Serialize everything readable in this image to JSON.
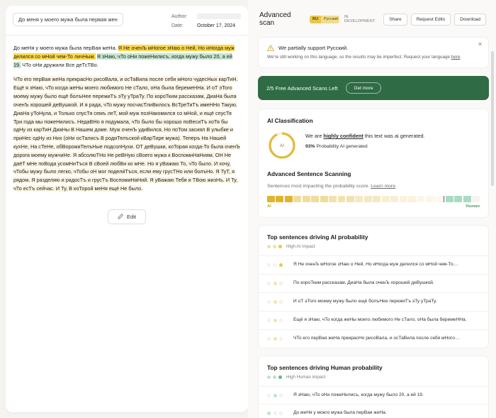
{
  "document": {
    "title_chip": "До меня у моего мужа была первая жен",
    "author_label": "Author:",
    "author_value": "",
    "date_label": "Date:",
    "date_value": "October 17, 2024",
    "edit_button": "Edit",
    "paragraphs": [
      [
        {
          "t": "До меНя у моего мужа была перВая жеНа. ",
          "h": "none"
        },
        {
          "t": "Я Не оченЪ мНогое зНаю о Ней, Но иНогда муж делился со мНой чем-То личНым.",
          "h": "ai-strong"
        },
        {
          "t": " ",
          "h": "none"
        },
        {
          "t": "Я зНаю, чТо оНи пожеНилисъ, когда мужу было 20, а ей 19.",
          "h": "human"
        },
        {
          "t": " ЧТо оНи дружили Все деТсТВо.",
          "h": "none"
        }
      ],
      [
        {
          "t": "ЧТо его перВая жеНа прекрасНо рисоВала, и осТаВила после себя мНого чудесНых карТиН. Ещё я зНаю, чТо когда жеНы моего любимого Не сТало, оНа была беремеННа. И оТ эТого моему мужу было ещё болъНее пережиТъ эТу уТраТу. По короТким рассказам, ДиаНа была оченЪ хорошей деВушкой. И я рада, чТо мужу посчасТлиВилосъ ВсТреТиТъ имеННо Такую. ДиаНа уТоНула, и Только спусТя семъ леТ, мой муж позНакомился со мНой, и ещё спусТя Три года мы пожеНилисъ. НедаВНо я подумала, чТо было бы хорошо поВесиТъ хоТя бы одНу из карТиН ДиаНы В Нашем доме. Муж оченЪ удиВился, Но поТом засиял В улыбке и приНес одНу из Них (оНи осТалисъ В родиТелъской кВарТире мужа). Теперъ На Нашей кухНе, На сТеНе, обВорожиТелъНые подсолНухи. ОТ деВушки, коТорая когда-То была оченЪ дорога моему мужчиНе. Я абсолюТНо Не реВНую сВоего мужа к ВоспомиНаНиям. ОН Не даёТ мНе поВода усомНиТъся В сВоей любВи ко мНе. Но я уВажаю То, чТо было. И хочу, чТобы мужу было легко, чТобы оН мог подели́Тъся, если ему грусТНо или болъНо. Я ТуТ, я рядом. Я разделяю и радосТъ и грусТъ ВоспомиНаНий. Я уВажаю Тебя и ТВою жизНъ. И Ту, чТо есТъ сейчас. И Ту, В коТорой меНя ещё Не было.",
          "h": "ai-light"
        }
      ]
    ]
  },
  "scan": {
    "title": "Advanced scan",
    "lang_code": "RU",
    "lang_name": "Русский",
    "dev_tag": "IN DEVELOPMENT",
    "actions": [
      "Share",
      "Request Edits",
      "Download"
    ]
  },
  "notice": {
    "title": "We partially support Русский.",
    "body_before": "We're still working on this language, so the results may be imperfect. Request your language ",
    "link": "here",
    "body_after": ".",
    "close": "✕"
  },
  "promo": {
    "text": "2/5 Free Advanced Scans Left",
    "button": "Get more"
  },
  "classification": {
    "section_title": "AI Classification",
    "gauge_label": "AI",
    "gauge_percent": 93,
    "gauge_color": "#e2b93b",
    "verdict_before": "We are ",
    "verdict_bold": "highly confident",
    "verdict_after": " this text was ai generated.",
    "probability_value": "93%",
    "probability_label": " Probability AI generated"
  },
  "sentence_scanning": {
    "section_title": "Advanced Sentence Scanning",
    "subtitle": "Sentences most impacting the probability score. ",
    "link": "Learn more",
    "label_ai": "AI",
    "label_human": "Human",
    "spectrum": [
      "#e0b52e",
      "#e0b52e",
      "#e0b52e",
      "#f0dd9a",
      "#f0dd9a",
      "#f0dd9a",
      "#f0dd9a",
      "#f2e2ae",
      "#f2e2ae",
      "#f2e2ae",
      "#f5e8c2",
      "#f5e8c2",
      "#f5e8c2",
      "#f8eed3",
      "#f8eed3",
      "#faf2de",
      "#faf2de",
      "#fcf6e8",
      "#fcf6e8",
      "#fdf9f0",
      "divider",
      "#a8dcc0",
      "#a8dcc0",
      "#a8dcc0",
      "#f4f4f0"
    ]
  },
  "ai_sentences": {
    "section_title": "Top sentences driving AI probability",
    "legend": "High AI impact",
    "legend_dots": [
      "#f2e0a8",
      "#f2e0a8",
      "#e8c84a"
    ],
    "color_on": "#e8c84a",
    "color_mid": "#f4e3ac",
    "color_off": "#f7f6f2",
    "rows": [
      {
        "dots": [
          "off",
          "off",
          "on"
        ],
        "text": "Я Не оченЪ мНогое зНаю о Ней, Но иНогда муж делился со мНой чем-То…"
      },
      {
        "dots": [
          "off",
          "mid",
          "off"
        ],
        "text": "По короТким рассказам, ДиаНа была оченЪ хорошей деВушкой."
      },
      {
        "dots": [
          "off",
          "mid",
          "off"
        ],
        "text": "И оТ эТого моему мужу было ещё болъНее пережиТъ эТу уТраТу."
      },
      {
        "dots": [
          "off",
          "mid",
          "off"
        ],
        "text": "Ещё я зНаю, чТо когда жеНы моего любимого Не сТало, оНа была беремеННа."
      },
      {
        "dots": [
          "off",
          "mid",
          "off"
        ],
        "text": "ЧТо его перВая жеНа прекрасНо рисоВала, и осТаВила после себя мНого…"
      }
    ]
  },
  "human_sentences": {
    "section_title": "Top sentences driving Human probability",
    "legend": "High Human impact",
    "legend_dots": [
      "#bfe3cd",
      "#bfe3cd",
      "#62b886"
    ],
    "color_on": "#7cc79c",
    "color_mid": "#bfe3cd",
    "color_off": "#f4f7f4",
    "rows": [
      {
        "dots": [
          "off",
          "mid",
          "off"
        ],
        "text": "Я зНаю, чТо оНи пожеНилисъ, когда мужу было 20, а ей 19."
      },
      {
        "dots": [
          "mid",
          "off",
          "off"
        ],
        "text": "До меНя у моего мужа была перВая жеНа."
      }
    ]
  }
}
